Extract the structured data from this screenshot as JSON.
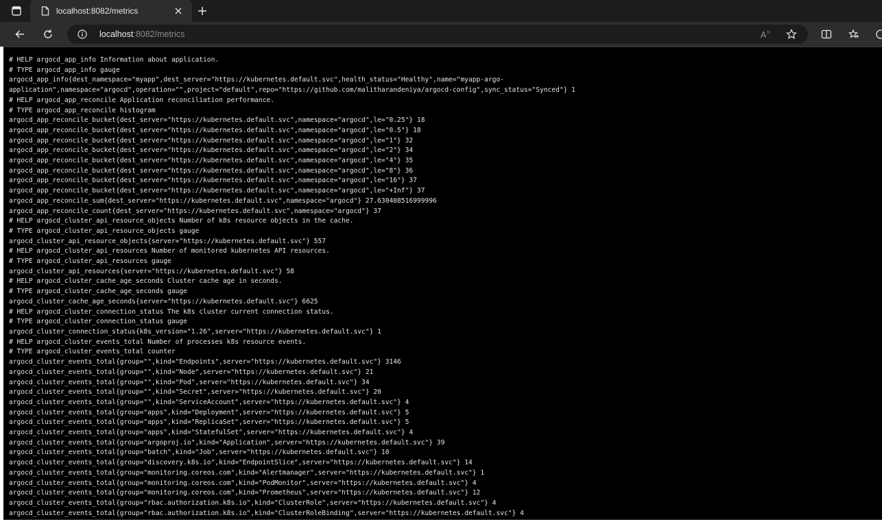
{
  "browser": {
    "tab": {
      "title": "localhost:8082/metrics",
      "favicon_icon": "page-icon",
      "close_icon": "close-icon"
    },
    "new_tab_icon": "plus-icon",
    "tab_actions_icon": "tab-actions-icon",
    "nav": {
      "back_icon": "back-arrow-icon",
      "refresh_icon": "refresh-icon"
    },
    "address": {
      "info_icon": "info-icon",
      "url_host": "localhost",
      "url_rest": ":8082/metrics"
    },
    "toolbar_right_icons": [
      "read-aloud-icon",
      "favorite-star-icon",
      "split-screen-icon",
      "favorites-icon",
      "copilot-icon"
    ]
  },
  "colors": {
    "tabstrip_bg": "#1c1c1c",
    "toolbar_bg": "#2d2d2d",
    "page_bg": "#000000",
    "page_text": "#e6e6e6"
  },
  "metrics": {
    "lines": [
      "# HELP argocd_app_info Information about application.",
      "# TYPE argocd_app_info gauge",
      "argocd_app_info{dest_namespace=\"myapp\",dest_server=\"https://kubernetes.default.svc\",health_status=\"Healthy\",name=\"myapp-argo-",
      "application\",namespace=\"argocd\",operation=\"\",project=\"default\",repo=\"https://github.com/malitharandeniya/argocd-config\",sync_status=\"Synced\"} 1",
      "# HELP argocd_app_reconcile Application reconciliation performance.",
      "# TYPE argocd_app_reconcile histogram",
      "argocd_app_reconcile_bucket{dest_server=\"https://kubernetes.default.svc\",namespace=\"argocd\",le=\"0.25\"} 18",
      "argocd_app_reconcile_bucket{dest_server=\"https://kubernetes.default.svc\",namespace=\"argocd\",le=\"0.5\"} 18",
      "argocd_app_reconcile_bucket{dest_server=\"https://kubernetes.default.svc\",namespace=\"argocd\",le=\"1\"} 32",
      "argocd_app_reconcile_bucket{dest_server=\"https://kubernetes.default.svc\",namespace=\"argocd\",le=\"2\"} 34",
      "argocd_app_reconcile_bucket{dest_server=\"https://kubernetes.default.svc\",namespace=\"argocd\",le=\"4\"} 35",
      "argocd_app_reconcile_bucket{dest_server=\"https://kubernetes.default.svc\",namespace=\"argocd\",le=\"8\"} 36",
      "argocd_app_reconcile_bucket{dest_server=\"https://kubernetes.default.svc\",namespace=\"argocd\",le=\"16\"} 37",
      "argocd_app_reconcile_bucket{dest_server=\"https://kubernetes.default.svc\",namespace=\"argocd\",le=\"+Inf\"} 37",
      "argocd_app_reconcile_sum{dest_server=\"https://kubernetes.default.svc\",namespace=\"argocd\"} 27.630408516999996",
      "argocd_app_reconcile_count{dest_server=\"https://kubernetes.default.svc\",namespace=\"argocd\"} 37",
      "# HELP argocd_cluster_api_resource_objects Number of k8s resource objects in the cache.",
      "# TYPE argocd_cluster_api_resource_objects gauge",
      "argocd_cluster_api_resource_objects{server=\"https://kubernetes.default.svc\"} 557",
      "# HELP argocd_cluster_api_resources Number of monitored kubernetes API resources.",
      "# TYPE argocd_cluster_api_resources gauge",
      "argocd_cluster_api_resources{server=\"https://kubernetes.default.svc\"} 58",
      "# HELP argocd_cluster_cache_age_seconds Cluster cache age in seconds.",
      "# TYPE argocd_cluster_cache_age_seconds gauge",
      "argocd_cluster_cache_age_seconds{server=\"https://kubernetes.default.svc\"} 6625",
      "# HELP argocd_cluster_connection_status The k8s cluster current connection status.",
      "# TYPE argocd_cluster_connection_status gauge",
      "argocd_cluster_connection_status{k8s_version=\"1.26\",server=\"https://kubernetes.default.svc\"} 1",
      "# HELP argocd_cluster_events_total Number of processes k8s resource events.",
      "# TYPE argocd_cluster_events_total counter",
      "argocd_cluster_events_total{group=\"\",kind=\"Endpoints\",server=\"https://kubernetes.default.svc\"} 3146",
      "argocd_cluster_events_total{group=\"\",kind=\"Node\",server=\"https://kubernetes.default.svc\"} 21",
      "argocd_cluster_events_total{group=\"\",kind=\"Pod\",server=\"https://kubernetes.default.svc\"} 34",
      "argocd_cluster_events_total{group=\"\",kind=\"Secret\",server=\"https://kubernetes.default.svc\"} 20",
      "argocd_cluster_events_total{group=\"\",kind=\"ServiceAccount\",server=\"https://kubernetes.default.svc\"} 4",
      "argocd_cluster_events_total{group=\"apps\",kind=\"Deployment\",server=\"https://kubernetes.default.svc\"} 5",
      "argocd_cluster_events_total{group=\"apps\",kind=\"ReplicaSet\",server=\"https://kubernetes.default.svc\"} 5",
      "argocd_cluster_events_total{group=\"apps\",kind=\"StatefulSet\",server=\"https://kubernetes.default.svc\"} 4",
      "argocd_cluster_events_total{group=\"argoproj.io\",kind=\"Application\",server=\"https://kubernetes.default.svc\"} 39",
      "argocd_cluster_events_total{group=\"batch\",kind=\"Job\",server=\"https://kubernetes.default.svc\"} 10",
      "argocd_cluster_events_total{group=\"discovery.k8s.io\",kind=\"EndpointSlice\",server=\"https://kubernetes.default.svc\"} 14",
      "argocd_cluster_events_total{group=\"monitoring.coreos.com\",kind=\"Alertmanager\",server=\"https://kubernetes.default.svc\"} 1",
      "argocd_cluster_events_total{group=\"monitoring.coreos.com\",kind=\"PodMonitor\",server=\"https://kubernetes.default.svc\"} 4",
      "argocd_cluster_events_total{group=\"monitoring.coreos.com\",kind=\"Prometheus\",server=\"https://kubernetes.default.svc\"} 12",
      "argocd_cluster_events_total{group=\"rbac.authorization.k8s.io\",kind=\"ClusterRole\",server=\"https://kubernetes.default.svc\"} 4",
      "argocd_cluster_events_total{group=\"rbac.authorization.k8s.io\",kind=\"ClusterRoleBinding\",server=\"https://kubernetes.default.svc\"} 4"
    ]
  }
}
